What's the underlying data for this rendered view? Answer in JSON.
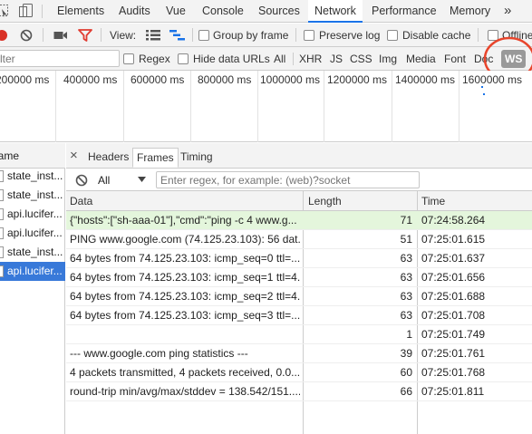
{
  "tabs": {
    "items": [
      "Elements",
      "Audits",
      "Vue",
      "Console",
      "Sources",
      "Network",
      "Performance",
      "Memory"
    ],
    "active": "Network",
    "overflow": "»"
  },
  "toolbar": {
    "view_label": "View:",
    "group_by_frame": "Group by frame",
    "preserve_log": "Preserve log",
    "disable_cache": "Disable cache",
    "offline": "Offline"
  },
  "filter": {
    "placeholder": "Filter",
    "regex": "Regex",
    "hide_data_urls": "Hide data URLs",
    "types": [
      "All",
      "XHR",
      "JS",
      "CSS",
      "Img",
      "Media",
      "Font",
      "Doc",
      "WS"
    ],
    "active_type": "WS"
  },
  "timeline": {
    "ticks": [
      "200000 ms",
      "400000 ms",
      "600000 ms",
      "800000 ms",
      "1000000 ms",
      "1200000 ms",
      "1400000 ms",
      "1600000 ms"
    ]
  },
  "requests": {
    "header": "Name",
    "items": [
      "state_inst...",
      "state_inst...",
      "api.lucifer...",
      "api.lucifer...",
      "state_inst...",
      "api.lucifer..."
    ],
    "selected_index": 5
  },
  "detail": {
    "close": "×",
    "tabs": [
      "Headers",
      "Frames",
      "Timing"
    ],
    "active_tab": "Frames",
    "frame_filter": {
      "select": "All",
      "placeholder": "Enter regex, for example: (web)?socket"
    },
    "columns": {
      "data": "Data",
      "length": "Length",
      "time": "Time"
    },
    "frames": [
      {
        "data": "{\"hosts\":[\"sh-aaa-01\"],\"cmd\":\"ping -c 4 www.g...",
        "length": "71",
        "time": "07:24:58.264",
        "type": "sent"
      },
      {
        "data": "PING www.google.com (74.125.23.103): 56 dat...",
        "length": "51",
        "time": "07:25:01.615",
        "type": "received"
      },
      {
        "data": "64 bytes from 74.125.23.103: icmp_seq=0 ttl=...",
        "length": "63",
        "time": "07:25:01.637",
        "type": "received"
      },
      {
        "data": "64 bytes from 74.125.23.103: icmp_seq=1 ttl=4...",
        "length": "63",
        "time": "07:25:01.656",
        "type": "received"
      },
      {
        "data": "64 bytes from 74.125.23.103: icmp_seq=2 ttl=4...",
        "length": "63",
        "time": "07:25:01.688",
        "type": "received"
      },
      {
        "data": "64 bytes from 74.125.23.103: icmp_seq=3 ttl=...",
        "length": "63",
        "time": "07:25:01.708",
        "type": "received"
      },
      {
        "data": "",
        "length": "1",
        "time": "07:25:01.749",
        "type": "received"
      },
      {
        "data": "--- www.google.com ping statistics ---",
        "length": "39",
        "time": "07:25:01.761",
        "type": "received"
      },
      {
        "data": "4 packets transmitted, 4 packets received, 0.0...",
        "length": "60",
        "time": "07:25:01.768",
        "type": "received"
      },
      {
        "data": "round-trip min/avg/max/stddev = 138.542/151....",
        "length": "66",
        "time": "07:25:01.811",
        "type": "received"
      }
    ]
  },
  "colors": {
    "record_red": "#d93025",
    "filter_red": "#e03c31",
    "accent_blue": "#1a73e8",
    "selected_row": "#3879d9",
    "sent_frame_bg": "#e4f6dc",
    "annotation_circle": "#e8452c"
  }
}
